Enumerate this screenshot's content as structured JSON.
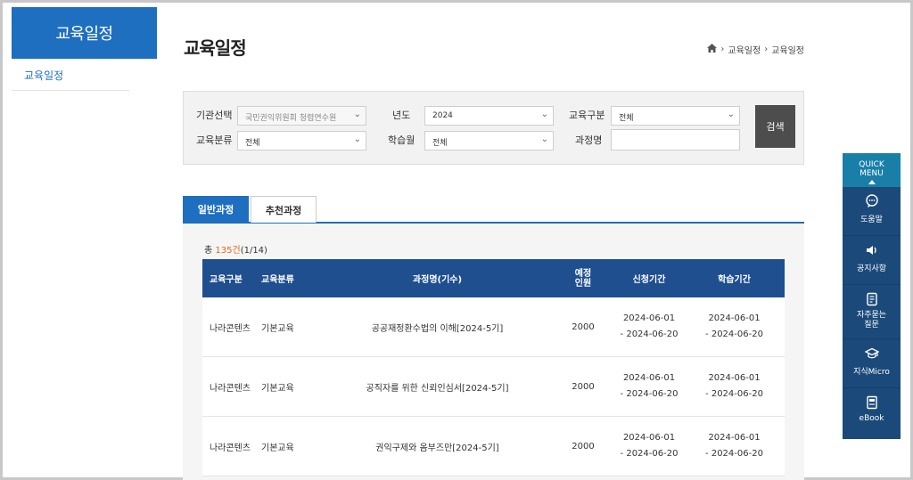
{
  "sidebar": {
    "title": "교육일정",
    "items": [
      {
        "label": "교육일정"
      }
    ]
  },
  "page": {
    "title": "교육일정"
  },
  "breadcrumb": {
    "home_icon": "home-icon",
    "items": [
      "교육일정",
      "교육일정"
    ]
  },
  "search": {
    "institution_label": "기관선택",
    "institution_value": "국민권익위원회 청렴연수원",
    "year_label": "년도",
    "year_value": "2024",
    "edu_type_label": "교육구분",
    "edu_type_value": "전체",
    "edu_category_label": "교육분류",
    "edu_category_value": "전체",
    "study_month_label": "학습월",
    "study_month_value": "전체",
    "course_name_label": "과정명",
    "course_name_value": "",
    "search_button": "검색"
  },
  "tabs": [
    {
      "label": "일반과정"
    },
    {
      "label": "추천과정"
    }
  ],
  "summary": {
    "prefix": "총 ",
    "count": "135건",
    "pages": "(1/14)"
  },
  "table": {
    "headers": [
      "교육구분",
      "교육분류",
      "과정명(기수)",
      "예정인원",
      "신청기간",
      "학습기간"
    ],
    "rows": [
      {
        "type": "나라콘텐츠",
        "category": "기본교육",
        "course": "공공재정환수법의 이해[2024-5기]",
        "capacity": "2000",
        "apply_start": "2024-06-01",
        "apply_end": "- 2024-06-20",
        "study_start": "2024-06-01",
        "study_end": "- 2024-06-20"
      },
      {
        "type": "나라콘텐츠",
        "category": "기본교육",
        "course": "공직자를 위한 신뢰인심서[2024-5기]",
        "capacity": "2000",
        "apply_start": "2024-06-01",
        "apply_end": "- 2024-06-20",
        "study_start": "2024-06-01",
        "study_end": "- 2024-06-20"
      },
      {
        "type": "나라콘텐츠",
        "category": "기본교육",
        "course": "권익구제와 옴부즈만[2024-5기]",
        "capacity": "2000",
        "apply_start": "2024-06-01",
        "apply_end": "- 2024-06-20",
        "study_start": "2024-06-01",
        "study_end": "- 2024-06-20"
      }
    ]
  },
  "quick_menu": {
    "title_line1": "QUICK",
    "title_line2": "MENU",
    "items": [
      {
        "label": "도움말",
        "icon": "chat-bubble-icon"
      },
      {
        "label": "공지사항",
        "icon": "speaker-icon"
      },
      {
        "label": "자주묻는\n질문",
        "icon": "document-icon"
      },
      {
        "label": "지식Micro",
        "icon": "graduation-cap-icon"
      },
      {
        "label": "eBook",
        "icon": "book-icon"
      }
    ]
  },
  "colors": {
    "primary": "#1e6fc0",
    "table_header": "#1f4f8f",
    "quick_menu": "#1b4a7a",
    "accent": "#e06a1f"
  }
}
